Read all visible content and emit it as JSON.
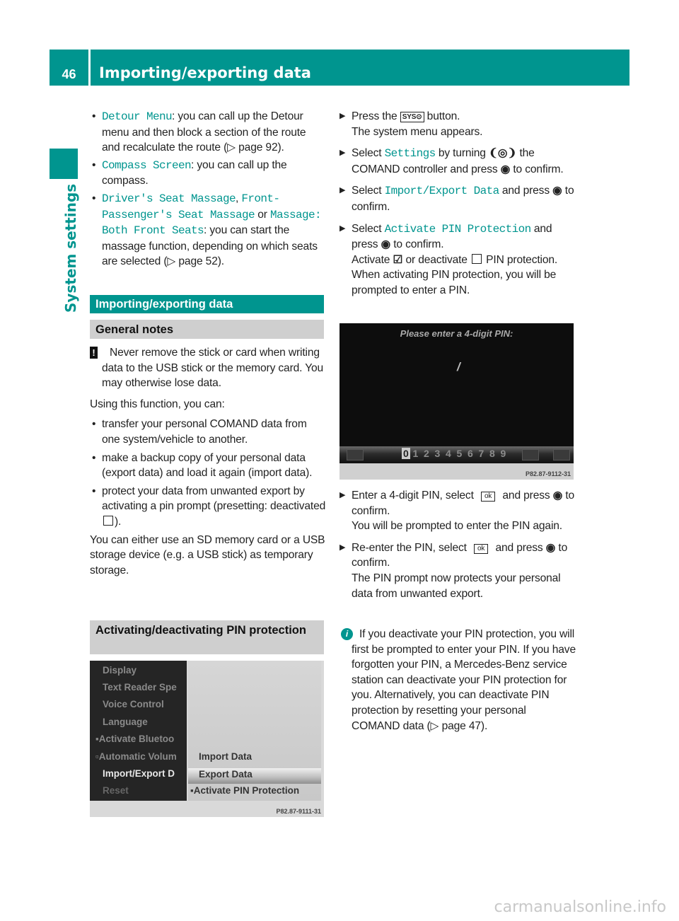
{
  "header": {
    "page_number": "46",
    "title": "Importing/exporting data"
  },
  "sidebar": {
    "section": "System settings"
  },
  "colors": {
    "brand_teal": "#00958f",
    "subheading_gray": "#cfcfcf"
  },
  "left": {
    "bullets_top": [
      [
        {
          "m": "Detour Menu"
        },
        {
          "t": ": you can call up the Detour menu and then block a section of the route and recalculate the route (▷ page 92)."
        }
      ],
      [
        {
          "m": "Compass Screen"
        },
        {
          "t": ": you can call up the compass."
        }
      ],
      [
        {
          "m": "Driver's Seat Massage"
        },
        {
          "t": ", "
        },
        {
          "m": "Front-Passenger's Seat Massage"
        },
        {
          "t": " or "
        },
        {
          "m": "Massage: Both Front Seats"
        },
        {
          "t": ": you can start the massage function, depending on which seats are selected (▷ page 52)."
        }
      ]
    ],
    "section_heading": "Importing/exporting data",
    "general_notes": "General notes",
    "warning_symbol": "!",
    "warning": "Never remove the stick or card when writing data to the USB stick or the memory card. You may otherwise lose data.",
    "intro": "Using this function, you can:",
    "bullets": [
      [
        {
          "t": "transfer your personal COMAND data from one system/vehicle to another."
        }
      ],
      [
        {
          "t": "make a backup copy of your personal data (export data) and load it again (import data)."
        }
      ],
      [
        {
          "t": "protect your data from unwanted export by activating a pin prompt (presetting: deactivated "
        },
        {
          "icon": "checkbox-empty-icon"
        },
        {
          "t": ")."
        }
      ]
    ],
    "storage": "You can either use an SD memory card or a USB storage device (e.g. a USB stick) as temporary storage.",
    "pin_heading": "Activating/deactivating PIN protection",
    "screenshot1": {
      "menu_items": [
        "Display",
        "Text Reader Spe",
        "Voice Control",
        "Language",
        "▪Activate Bluetoo",
        "▫Automatic Volum",
        "Import/Export D",
        "Reset"
      ],
      "submenu_items": [
        "Import Data",
        "Export Data",
        "▪Activate PIN Protection"
      ],
      "selected_submenu": "Export Data",
      "code": "P82.87-9111-31"
    }
  },
  "right": {
    "steps_top": [
      {
        "lines": [
          [
            {
              "t": "Press the "
            },
            {
              "icon": "sys-button-icon",
              "label": "SYS⊙"
            },
            {
              "t": " button."
            }
          ],
          [
            {
              "t": "The system menu appears."
            }
          ]
        ]
      },
      {
        "lines": [
          [
            {
              "t": "Select "
            },
            {
              "m": "Settings"
            },
            {
              "t": " by turning "
            },
            {
              "icon": "turn-controller-icon",
              "label": "❨◎❩"
            },
            {
              "t": " the COMAND controller and press "
            },
            {
              "icon": "press-controller-icon",
              "label": "◉"
            },
            {
              "t": " to confirm."
            }
          ]
        ]
      },
      {
        "lines": [
          [
            {
              "t": "Select "
            },
            {
              "m": "Import/Export Data"
            },
            {
              "t": " and press "
            },
            {
              "icon": "press-controller-icon",
              "label": "◉"
            },
            {
              "t": " to confirm."
            }
          ]
        ]
      },
      {
        "lines": [
          [
            {
              "t": "Select "
            },
            {
              "m": "Activate PIN Protection"
            },
            {
              "t": " and press "
            },
            {
              "icon": "press-controller-icon",
              "label": "◉"
            },
            {
              "t": " to confirm."
            }
          ],
          [
            {
              "t": "Activate "
            },
            {
              "icon": "checkbox-checked-icon",
              "label": "☑"
            },
            {
              "t": " or deactivate "
            },
            {
              "icon": "checkbox-empty-icon"
            },
            {
              "t": " PIN protection. When activating PIN protection, you will be prompted to enter a PIN."
            }
          ]
        ]
      }
    ],
    "screenshot2": {
      "prompt": "Please enter a 4-digit PIN:",
      "cursor": "/",
      "digits": [
        "0",
        "1",
        "2",
        "3",
        "4",
        "5",
        "6",
        "7",
        "8",
        "9"
      ],
      "selected_digit": "0",
      "code": "P82.87-9112-31"
    },
    "steps_bottom": [
      {
        "lines": [
          [
            {
              "t": "Enter a 4-digit PIN, select "
            },
            {
              "icon": "ok-button-icon",
              "label": "ok"
            },
            {
              "t": " and press "
            },
            {
              "icon": "press-controller-icon",
              "label": "◉"
            },
            {
              "t": " to confirm."
            }
          ],
          [
            {
              "t": "You will be prompted to enter the PIN again."
            }
          ]
        ]
      },
      {
        "lines": [
          [
            {
              "t": "Re-enter the PIN, select "
            },
            {
              "icon": "ok-button-icon",
              "label": "ok"
            },
            {
              "t": " and press "
            },
            {
              "icon": "press-controller-icon",
              "label": "◉"
            },
            {
              "t": " to confirm."
            }
          ],
          [
            {
              "t": "The PIN prompt now protects your personal data from unwanted export."
            }
          ]
        ]
      }
    ],
    "info_symbol": "i",
    "info": "If you deactivate your PIN protection, you will first be prompted to enter your PIN. If you have forgotten your PIN, a Mercedes-Benz service station can deactivate your PIN protection for you. Alternatively, you can deactivate PIN protection by resetting your personal COMAND data (▷ page 47)."
  },
  "watermark": "carmanualsonline.info"
}
